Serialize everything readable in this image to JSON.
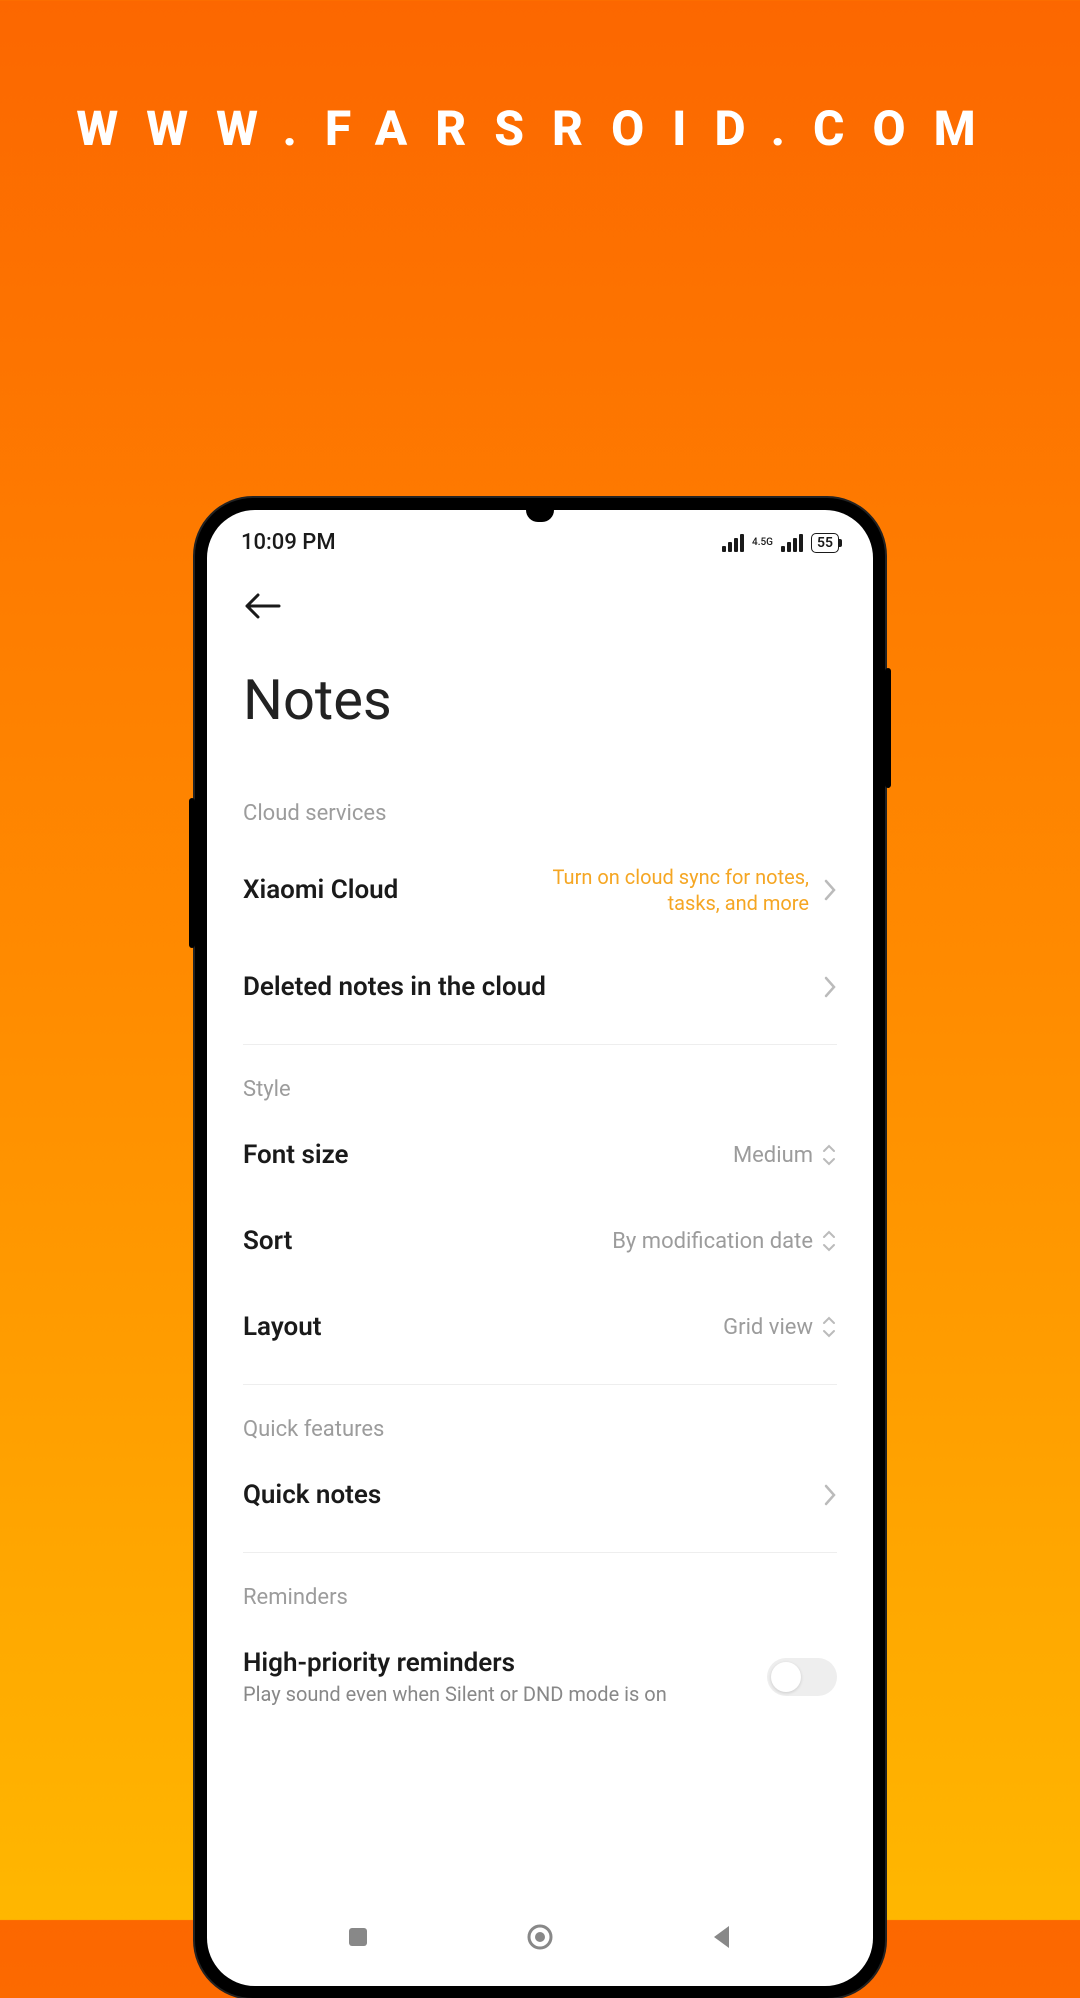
{
  "watermark": "WWW.FARSROID.COM",
  "status": {
    "time": "10:09 PM",
    "network": "4.5G",
    "battery": "55"
  },
  "page": {
    "title": "Notes"
  },
  "sections": {
    "cloud": {
      "header": "Cloud services",
      "xiaomi_cloud": {
        "title": "Xiaomi Cloud",
        "accent": "Turn on cloud sync for notes, tasks, and more"
      },
      "deleted": {
        "title": "Deleted notes in the cloud"
      }
    },
    "style": {
      "header": "Style",
      "font_size": {
        "title": "Font size",
        "value": "Medium"
      },
      "sort": {
        "title": "Sort",
        "value": "By modification date"
      },
      "layout": {
        "title": "Layout",
        "value": "Grid view"
      }
    },
    "quick": {
      "header": "Quick features",
      "quick_notes": {
        "title": "Quick notes"
      }
    },
    "reminders": {
      "header": "Reminders",
      "high_priority": {
        "title": "High-priority reminders",
        "sub": "Play sound even when Silent or DND mode is on"
      }
    }
  }
}
